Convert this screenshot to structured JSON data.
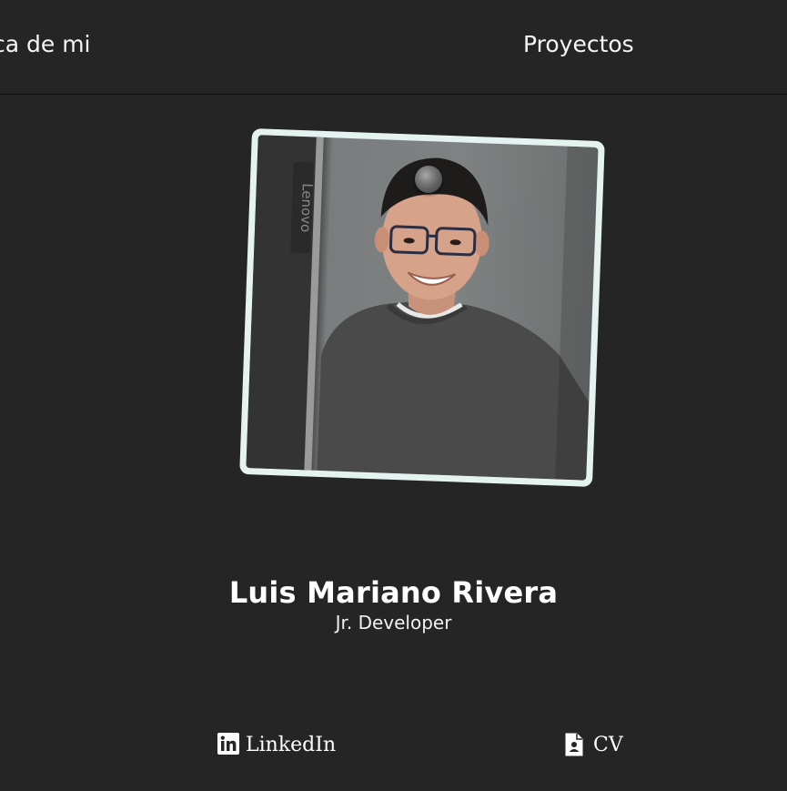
{
  "nav": {
    "about_label": "ca de mi",
    "projects_label": "Proyectos"
  },
  "profile": {
    "name": "Luis Mariano Rivera",
    "role": "Jr. Developer",
    "photo_alt": "Luis Mariano Rivera",
    "monitor_brand": "Lenovo"
  },
  "links": {
    "linkedin_label": "LinkedIn",
    "linkedin_icon": "linkedin-icon",
    "cv_label": "CV",
    "cv_icon": "document-icon"
  },
  "colors": {
    "background": "#252525",
    "frame": "#e4f2f0",
    "text": "#ffffff"
  }
}
